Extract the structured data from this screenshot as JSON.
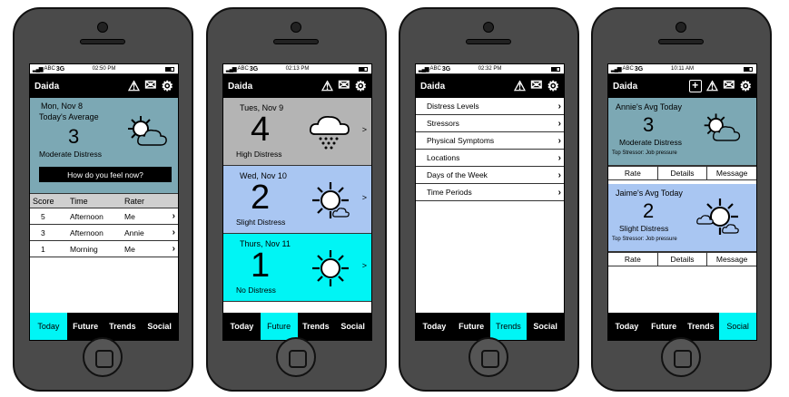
{
  "colors": {
    "card_teal": "#7ca8b4",
    "card_gray": "#b4b4b4",
    "card_blue": "#a9c6f2",
    "card_cyan": "#00f5f5",
    "tab_active": "#00f5f5"
  },
  "status_bar": {
    "carrier": "ABC",
    "network": "3G"
  },
  "tabs": [
    "Today",
    "Future",
    "Trends",
    "Social"
  ],
  "screen1": {
    "time": "02:50 PM",
    "app_title": "Daida",
    "card": {
      "date": "Mon, Nov 8",
      "label": "Today's Average",
      "score": "3",
      "level": "Moderate Distress",
      "icon": "sun-cloud-icon"
    },
    "feel_button": "How do you feel now?",
    "table": {
      "headers": [
        "Score",
        "Time",
        "Rater"
      ],
      "rows": [
        {
          "score": "5",
          "time": "Afternoon",
          "rater": "Me"
        },
        {
          "score": "3",
          "time": "Afternoon",
          "rater": "Annie"
        },
        {
          "score": "1",
          "time": "Morning",
          "rater": "Me"
        }
      ]
    },
    "active_tab": "Today"
  },
  "screen2": {
    "time": "02:13 PM",
    "app_title": "Daida",
    "forecast": [
      {
        "date": "Tues, Nov 9",
        "score": "4",
        "level": "High Distress",
        "icon": "rain-cloud-icon",
        "chevron": ">"
      },
      {
        "date": "Wed, Nov 10",
        "score": "2",
        "level": "Slight Distress",
        "icon": "sun-small-cloud-icon",
        "chevron": ">"
      },
      {
        "date": "Thurs, Nov 11",
        "score": "1",
        "level": "No Distress",
        "icon": "sun-icon",
        "chevron": ">"
      }
    ],
    "active_tab": "Future"
  },
  "screen3": {
    "time": "02:32 PM",
    "app_title": "Daida",
    "items": [
      "Distress Levels",
      "Stressors",
      "Physical Symptoms",
      "Locations",
      "Days of the Week",
      "Time Periods"
    ],
    "active_tab": "Trends"
  },
  "screen4": {
    "time": "10:11 AM",
    "app_title": "Daida",
    "friends": [
      {
        "name": "Annie's Avg Today",
        "score": "3",
        "level": "Moderate Distress",
        "stressor": "Top Stressor: Job pressure",
        "icon": "sun-cloud-icon"
      },
      {
        "name": "Jaime's Avg Today",
        "score": "2",
        "level": "Slight Distress",
        "stressor": "Top Stressor: Job pressure",
        "icon": "cloud-sun-icon"
      }
    ],
    "actions": [
      "Rate",
      "Details",
      "Message"
    ],
    "active_tab": "Social"
  }
}
